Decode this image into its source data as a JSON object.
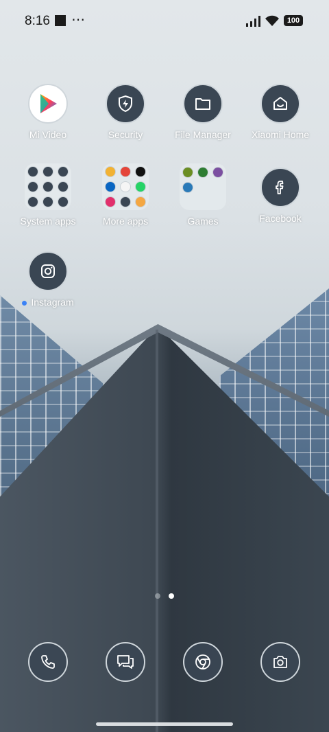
{
  "status_bar": {
    "time": "8:16",
    "overflow": "⋯",
    "battery": "100"
  },
  "apps": [
    {
      "label": "Mi Video",
      "icon": "mi-video-icon"
    },
    {
      "label": "Security",
      "icon": "security-shield-icon"
    },
    {
      "label": "File Manager",
      "icon": "folder-icon"
    },
    {
      "label": "Xiaomi Home",
      "icon": "xiaomi-home-icon"
    },
    {
      "label": "System apps",
      "icon": "folder-system-apps"
    },
    {
      "label": "More apps",
      "icon": "folder-more-apps"
    },
    {
      "label": "Games",
      "icon": "folder-games"
    },
    {
      "label": "Facebook",
      "icon": "facebook-icon"
    },
    {
      "label": "Instagram",
      "icon": "instagram-icon"
    }
  ],
  "page_indicator": {
    "pages": 2,
    "current": 2
  },
  "dock": [
    {
      "icon": "phone-icon"
    },
    {
      "icon": "messages-icon"
    },
    {
      "icon": "chrome-icon"
    },
    {
      "icon": "camera-icon"
    }
  ],
  "colors": {
    "icon_bg": "#3a4653",
    "accent_dot": "#3b82f6"
  }
}
